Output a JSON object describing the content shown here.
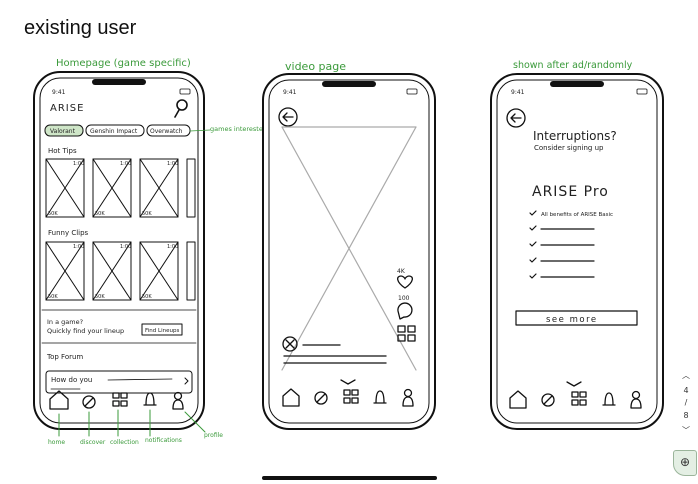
{
  "page_title": "existing user",
  "frames": {
    "home": {
      "annotation": "Homepage (game specific)",
      "time": "9:41",
      "app_name": "ARISE",
      "chips": [
        "Valorant",
        "Genshin Impact",
        "Overwatch"
      ],
      "chips_note": "games interested",
      "hot_tips_heading": "Hot Tips",
      "duration": "1:00",
      "views": "50K",
      "funny_clips_heading": "Funny Clips",
      "in_game_line1": "In a game?",
      "in_game_line2": "Quickly find your lineup",
      "find_lineups_label": "Find Lineups",
      "top_forum_heading": "Top Forum",
      "forum_text": "How do you",
      "nav_notes": [
        "home",
        "discover",
        "collection",
        "notifications",
        "profile"
      ]
    },
    "video": {
      "annotation": "video page",
      "time": "9:41",
      "likes": "4K",
      "comments": "100"
    },
    "pro": {
      "annotation": "shown after ad/randomly",
      "time": "9:41",
      "headline": "Interruptions?",
      "subhead": "Consider signing up",
      "product": "ARISE Pro",
      "benefit": "All benefits of ARISE Basic",
      "see_more_label": "see more"
    }
  },
  "pager": {
    "current": "4",
    "separator": "/",
    "total": "8"
  },
  "icons": [
    "home-icon",
    "discover-icon",
    "collection-icon",
    "notifications-icon",
    "profile-icon",
    "back-icon",
    "search-icon",
    "heart-icon",
    "comment-icon",
    "collection-icon",
    "close-icon",
    "zoom-icon"
  ]
}
